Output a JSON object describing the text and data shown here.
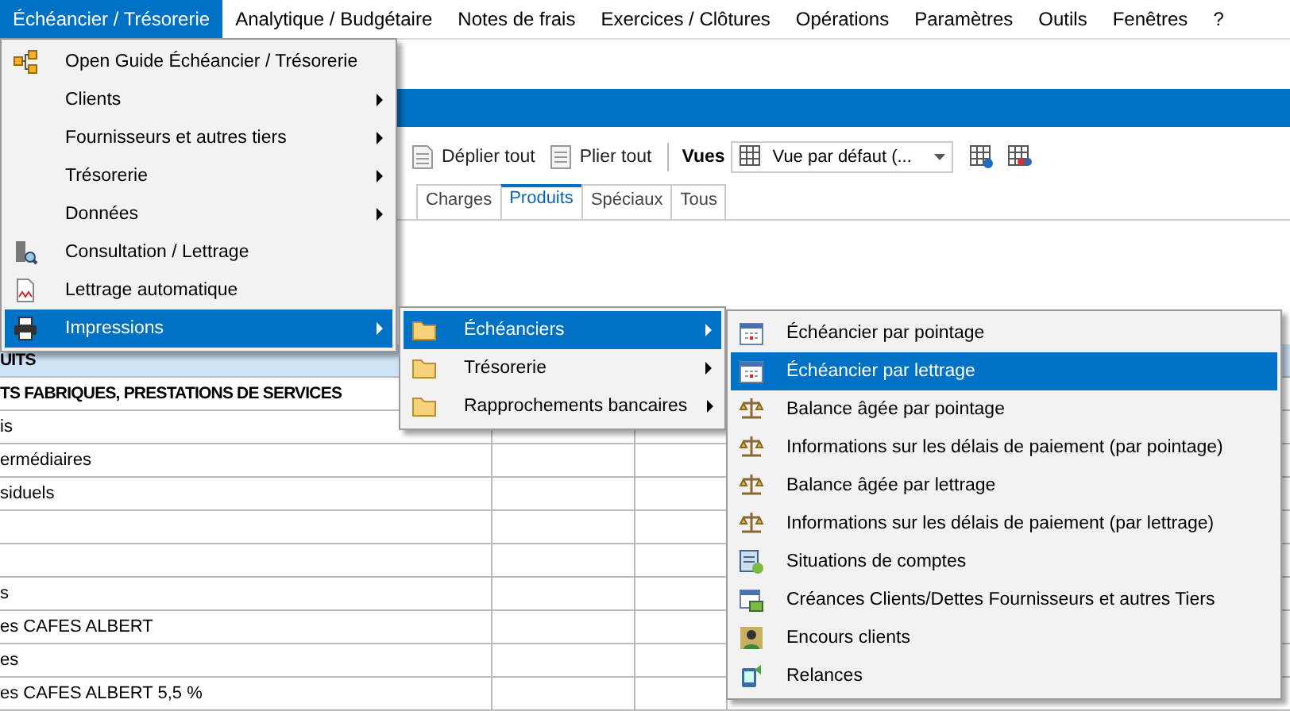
{
  "menubar": [
    {
      "label": "Échéancier / Trésorerie",
      "selected": true
    },
    {
      "label": "Analytique / Budgétaire",
      "selected": false
    },
    {
      "label": "Notes de frais",
      "selected": false
    },
    {
      "label": "Exercices / Clôtures",
      "selected": false
    },
    {
      "label": "Opérations",
      "selected": false
    },
    {
      "label": "Paramètres",
      "selected": false
    },
    {
      "label": "Outils",
      "selected": false
    },
    {
      "label": "Fenêtres",
      "selected": false
    },
    {
      "label": "?",
      "selected": false
    }
  ],
  "toolbar": {
    "expand_all": "Déplier tout",
    "collapse_all": "Plier tout",
    "views_label": "Vues",
    "view_dropdown": "Vue par défaut (..."
  },
  "tabs": [
    {
      "label": "Charges",
      "selected": false
    },
    {
      "label": "Produits",
      "selected": true
    },
    {
      "label": "Spéciaux",
      "selected": false
    },
    {
      "label": "Tous",
      "selected": false
    }
  ],
  "table": {
    "rows": [
      {
        "column_1": "UITS",
        "bold": true,
        "selected": true
      },
      {
        "column_1": "TS FABRIQUES, PRESTATIONS DE SERVICES",
        "bold": true,
        "selected": false
      },
      {
        "column_1": "is",
        "bold": false,
        "selected": false
      },
      {
        "column_1": "ermédiaires",
        "bold": false,
        "selected": false
      },
      {
        "column_1": "siduels",
        "bold": false,
        "selected": false
      },
      {
        "selected": false
      },
      {
        "selected": false
      },
      {
        "column_1": "s",
        "bold": false,
        "selected": false
      },
      {
        "column_1": "es CAFES ALBERT",
        "bold": false,
        "selected": false
      },
      {
        "column_1": "es",
        "bold": false,
        "selected": false
      },
      {
        "column_1": "es CAFES ALBERT 5,5 %",
        "bold": false,
        "selected": false
      }
    ]
  },
  "menu": {
    "items": [
      {
        "label": "Open Guide Échéancier / Trésorerie",
        "has_submenu": false,
        "selected": false
      },
      {
        "label": "Clients",
        "has_submenu": true,
        "selected": false
      },
      {
        "label": "Fournisseurs et autres tiers",
        "has_submenu": true,
        "selected": false
      },
      {
        "label": "Trésorerie",
        "has_submenu": true,
        "selected": false
      },
      {
        "label": "Données",
        "has_submenu": true,
        "selected": false
      },
      {
        "label": "Consultation / Lettrage",
        "has_submenu": false,
        "selected": false
      },
      {
        "label": "Lettrage automatique",
        "has_submenu": false,
        "selected": false
      },
      {
        "label": "Impressions",
        "has_submenu": true,
        "selected": true
      }
    ]
  },
  "submenu": {
    "items": [
      {
        "label": "Échéanciers",
        "has_submenu": true,
        "selected": true
      },
      {
        "label": "Trésorerie",
        "has_submenu": true,
        "selected": false
      },
      {
        "label": "Rapprochements bancaires",
        "has_submenu": true,
        "selected": false
      }
    ]
  },
  "submenu_2": {
    "items": [
      {
        "label": "Échéancier par pointage",
        "selected": false
      },
      {
        "label": "Échéancier par lettrage",
        "selected": true
      },
      {
        "label": "Balance âgée par pointage",
        "selected": false
      },
      {
        "label": "Informations sur les délais de paiement (par pointage)",
        "selected": false
      },
      {
        "label": "Balance âgée par lettrage",
        "selected": false
      },
      {
        "label": "Informations sur les délais de paiement (par lettrage)",
        "selected": false
      },
      {
        "label": "Situations de comptes",
        "selected": false
      },
      {
        "label": "Créances Clients/Dettes Fournisseurs et autres Tiers",
        "selected": false
      },
      {
        "label": "Encours clients",
        "selected": false
      },
      {
        "label": "Relances",
        "selected": false
      }
    ]
  }
}
